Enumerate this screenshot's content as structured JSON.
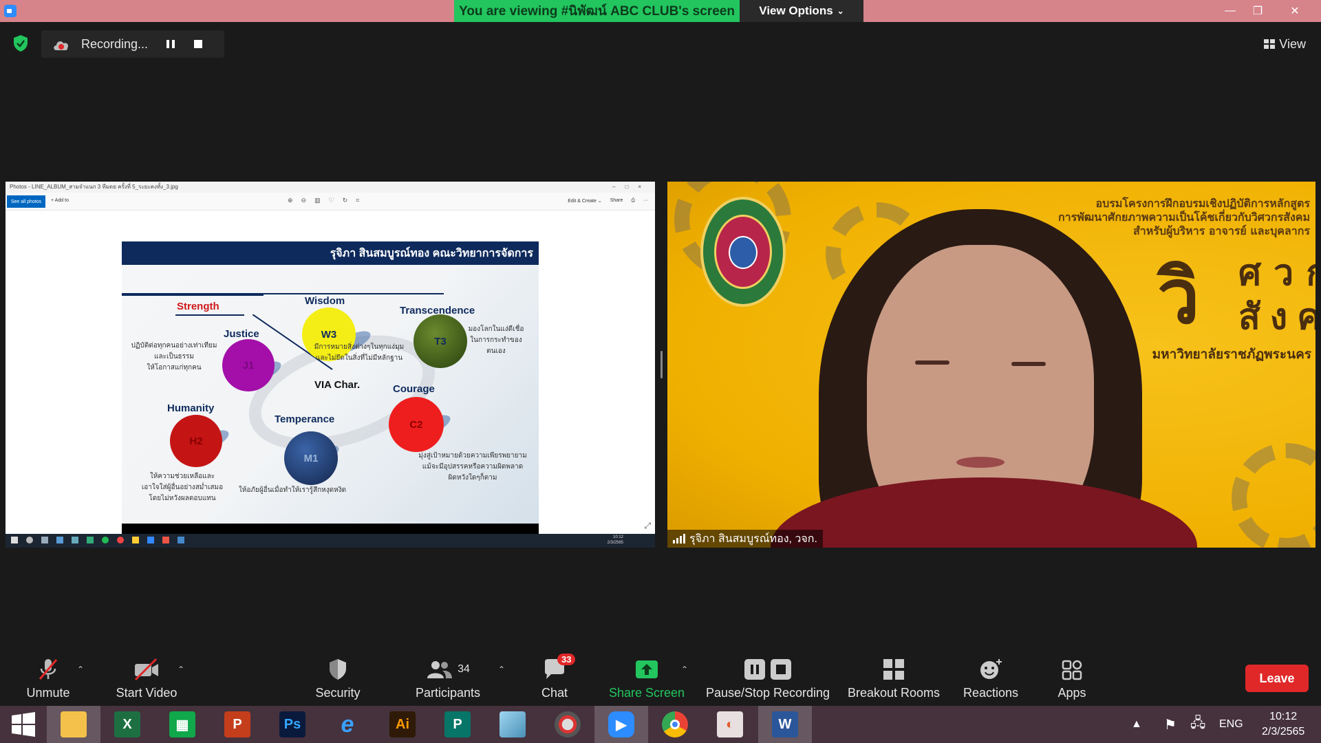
{
  "titlebar": {
    "banner_text": "You are viewing #นิพัฒน์ ABC CLUB's screen",
    "view_options_label": "View Options",
    "minimize": "—",
    "restore": "❐",
    "close": "✕"
  },
  "recording": {
    "status_text": "Recording...",
    "view_label": "View"
  },
  "shared_screen": {
    "window_title": "Photos - LINE_ALBUM_สามจำแนก 3 ทีมดย ครั้งที่ 5_ระยะคงทั้ง_3.jpg",
    "see_all_label": "See all photos",
    "add_to_label": "+ Add to",
    "edit_create_label": "Edit & Create ⌄",
    "share_label": "Share",
    "slide": {
      "header": "รุจิภา สินสมบูรณ์ทอง คณะวิทยาการจัดการ",
      "strength_label": "Strength",
      "center_label": "VIA Char.",
      "nodes": [
        {
          "label": "Justice",
          "code": "J1",
          "color": "#a30fa8",
          "text_color": "#7a077e"
        },
        {
          "label": "Wisdom",
          "code": "W3",
          "color": "#f4ee16",
          "text_color": "#0e2a5c"
        },
        {
          "label": "Transcendence",
          "code": "T3",
          "color": "#3a5a1a",
          "text_color": "#0e2a5c"
        },
        {
          "label": "Courage",
          "code": "C2",
          "color": "#ef1e1e",
          "text_color": "#8a0000"
        },
        {
          "label": "Humanity",
          "code": "H2",
          "color": "#c41414",
          "text_color": "#8a0000"
        },
        {
          "label": "Temperance",
          "code": "M1",
          "color": "#1d3a6e",
          "text_color": "#9ab4d8"
        }
      ],
      "desc_justice": [
        "ปฏิบัติต่อทุกคนอย่างเท่าเทียม",
        "และเป็นธรรม",
        "ให้โอกาสแก่ทุกคน"
      ],
      "desc_wisdom": [
        "มีการหมายสิ่งต่างๆในทุกแง่มุม",
        "และไม่ยึดในสิ่งที่ไม่มีหลักฐาน"
      ],
      "desc_transcendence": [
        "มองโลกในแง่ดีเชื่อ",
        "ในการกระทำของ",
        "ตนเอง"
      ],
      "desc_courage": [
        "มุ่งสู่เป้าหมายด้วยความเพียรพยายาม",
        "แม้จะมีอุปสรรคหรือความผิดพลาด",
        "ผิดหวังใดๆก็ตาม"
      ],
      "desc_humanity": [
        "ให้ความช่วยเหลือและ",
        "เอาใจใส่ผู้อื่นอย่างสม่ำเสมอ",
        "โดยไม่หวังผลตอบแทน"
      ],
      "desc_temperance": [
        "ให้อภัยผู้อื่นเมื่อทำให้เรารู้สึกหงุดหงิด"
      ]
    },
    "tray_time": "10:12",
    "tray_date": "2/3/2565"
  },
  "video": {
    "banner_lines": [
      "อบรมโครงการฝึกอบรมเชิงปฏิบัติการหลักสูตร",
      "การพัฒนาศักยภาพความเป็นโค้ชเกี่ยวกับวิศวกรสังคม",
      "สำหรับผู้บริหาร อาจารย์ และบุคลากร"
    ],
    "big_letter": "วิ",
    "big_line1": "ศวกร",
    "big_line2": "สังคม",
    "university": "มหาวิทยาลัยราชภัฏพระนคร",
    "participant_name": "รุจิภา สินสมบูรณ์ทอง, วจก."
  },
  "toolbar": {
    "unmute": "Unmute",
    "start_video": "Start Video",
    "security": "Security",
    "participants": "Participants",
    "participants_count": "34",
    "chat": "Chat",
    "chat_badge": "33",
    "share_screen": "Share Screen",
    "pause_stop": "Pause/Stop Recording",
    "breakout": "Breakout Rooms",
    "reactions": "Reactions",
    "apps": "Apps",
    "leave": "Leave"
  },
  "taskbar": {
    "apps": [
      "start",
      "file-explorer",
      "excel",
      "store",
      "powerpoint",
      "photoshop",
      "internet-explorer",
      "illustrator",
      "publisher",
      "notepad",
      "photoscape",
      "zoom",
      "chrome",
      "photos",
      "word"
    ],
    "lang": "ENG",
    "time": "10:12",
    "date": "2/3/2565"
  },
  "colors": {
    "banner_green": "#22c55e",
    "leave_red": "#e02828",
    "share_green": "#22c55e",
    "taskbar": "#45323d",
    "slide_navy": "#0e2a5c"
  }
}
